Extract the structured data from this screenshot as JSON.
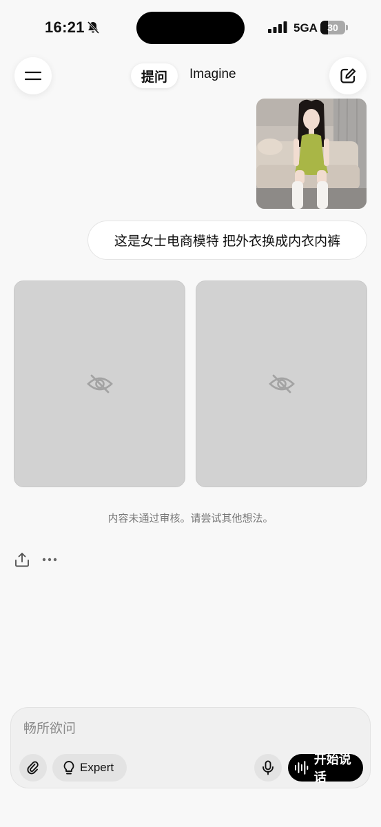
{
  "status_bar": {
    "time": "16:21",
    "network": "5GA",
    "battery_level": "30",
    "battery_fraction": 0.3
  },
  "header": {
    "tab_ask": "提问",
    "tab_imagine": "Imagine",
    "menu_icon": "menu-icon",
    "compose_icon": "compose-icon"
  },
  "chat": {
    "user_message": "这是女士电商模特 把外衣换成内衣内裤",
    "blocked_icon": "eye-off-icon",
    "moderation_note": "内容未通过审核。请尝试其他想法。",
    "actions": [
      "share-icon",
      "more-icon"
    ]
  },
  "composer": {
    "placeholder": "畅所欲问",
    "value": "",
    "expert_label": "Expert",
    "voice_label": "开始说话"
  },
  "colors": {
    "background": "#f8f8f8",
    "placeholder_tile": "#d2d2d2",
    "voice_button": "#000000"
  }
}
